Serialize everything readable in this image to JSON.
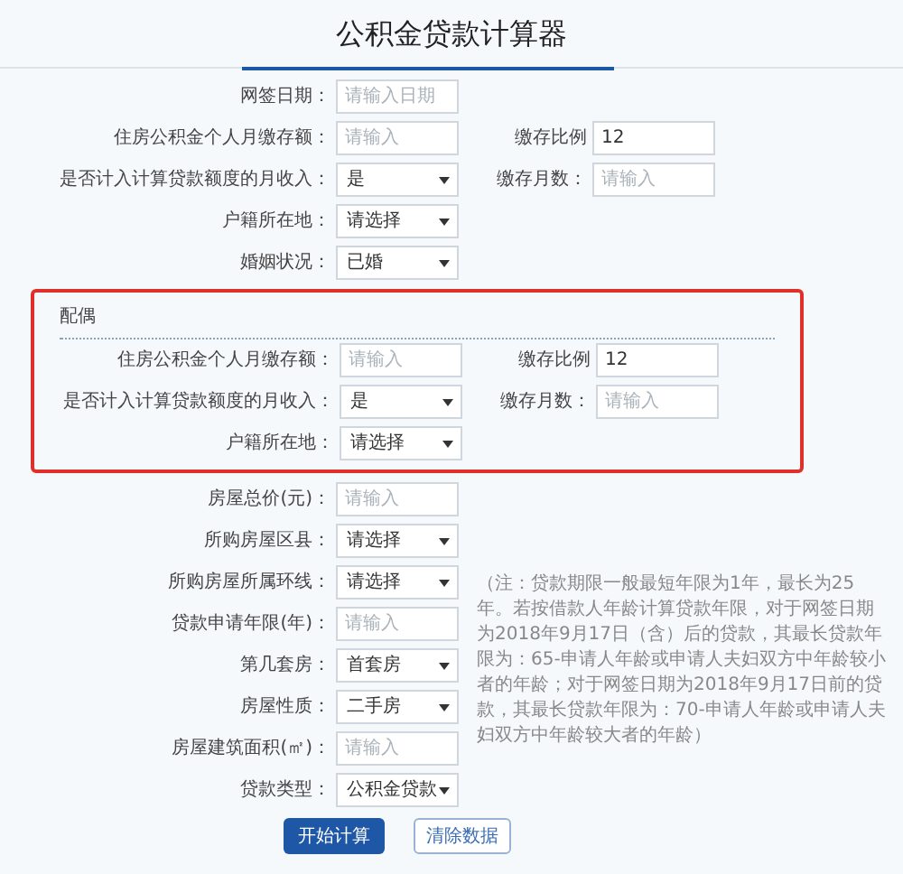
{
  "title": "公积金贷款计算器",
  "applicant_rows": [
    {
      "left": {
        "label": "网签日期：",
        "kind": "input",
        "placeholder": "请输入日期"
      }
    },
    {
      "left": {
        "label": "住房公积金个人月缴存额：",
        "kind": "input",
        "placeholder": "请输入"
      },
      "right": {
        "label": "缴存比例",
        "kind": "input",
        "value": "12"
      }
    },
    {
      "left": {
        "label": "是否计入计算贷款额度的月收入：",
        "kind": "select",
        "value": "是"
      },
      "right": {
        "label": "缴存月数：",
        "kind": "input",
        "placeholder": "请输入"
      }
    },
    {
      "left": {
        "label": "户籍所在地：",
        "kind": "select",
        "value": "请选择"
      }
    },
    {
      "left": {
        "label": "婚姻状况：",
        "kind": "select",
        "value": "已婚"
      }
    }
  ],
  "spouse": {
    "title": "配偶",
    "rows": [
      {
        "left": {
          "label": "住房公积金个人月缴存额：",
          "kind": "input",
          "placeholder": "请输入"
        },
        "right": {
          "label": "缴存比例",
          "kind": "input",
          "value": "12"
        }
      },
      {
        "left": {
          "label": "是否计入计算贷款额度的月收入：",
          "kind": "select",
          "value": "是"
        },
        "right": {
          "label": "缴存月数：",
          "kind": "input",
          "placeholder": "请输入"
        }
      },
      {
        "left": {
          "label": "户籍所在地：",
          "kind": "select",
          "value": "请选择"
        }
      }
    ]
  },
  "property_rows": [
    {
      "left": {
        "label": "房屋总价(元)：",
        "kind": "input",
        "placeholder": "请输入"
      }
    },
    {
      "left": {
        "label": "所购房屋区县：",
        "kind": "select",
        "value": "请选择"
      }
    },
    {
      "left": {
        "label": "所购房屋所属环线：",
        "kind": "select",
        "value": "请选择"
      }
    },
    {
      "left": {
        "label": "贷款申请年限(年)：",
        "kind": "input",
        "placeholder": "请输入"
      }
    },
    {
      "left": {
        "label": "第几套房：",
        "kind": "select",
        "value": "首套房"
      }
    },
    {
      "left": {
        "label": "房屋性质：",
        "kind": "select",
        "value": "二手房"
      }
    },
    {
      "left": {
        "label": "房屋建筑面积(㎡)：",
        "kind": "input",
        "placeholder": "请输入"
      }
    },
    {
      "left": {
        "label": "贷款类型：",
        "kind": "select",
        "value": "公积金贷款"
      }
    }
  ],
  "note": "（注：贷款期限一般最短年限为1年，最长为25年。若按借款人年龄计算贷款年限，对于网签日期为2018年9月17日（含）后的贷款，其最长贷款年限为：65-申请人年龄或申请人夫妇双方中年龄较小者的年龄；对于网签日期为2018年9月17日前的贷款，其最长贷款年限为：70-申请人年龄或申请人夫妇双方中年龄较大者的年龄）",
  "buttons": [
    {
      "label": "开始计算",
      "kind": "primary"
    },
    {
      "label": "清除数据",
      "kind": "secondary"
    }
  ]
}
